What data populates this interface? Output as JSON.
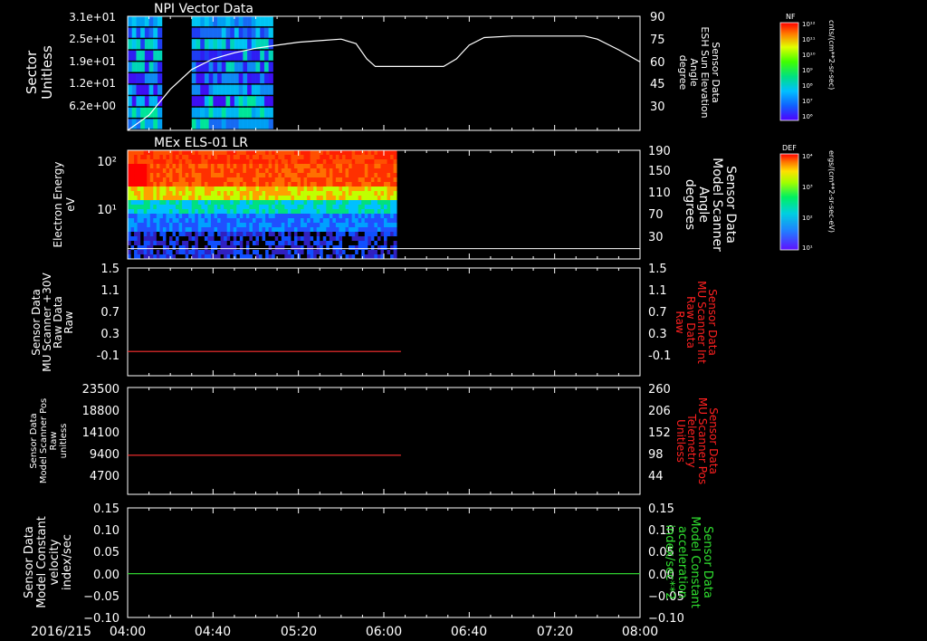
{
  "colors": {
    "background": "#000000",
    "axis": "#ffffff",
    "right_red": "#ff2020",
    "right_green": "#30e030",
    "line_red": "#ff3030",
    "line_green": "#30d030",
    "line_white": "#ffffff"
  },
  "date_label": "2016/215",
  "chart_data": [
    {
      "type": "heatmap",
      "title": "NPI Vector Data",
      "ylabel": [
        "Sector",
        "Unitless"
      ],
      "yticks": [
        "3.1e+01",
        "2.5e+01",
        "1.9e+01",
        "1.2e+01",
        "6.2e+00"
      ],
      "right_label": [
        "Sensor Data",
        "ESH Sun Elevation",
        "Angle",
        "degree"
      ],
      "right_ticks": [
        "90",
        "75",
        "60",
        "45",
        "30"
      ],
      "right_range": [
        15,
        90
      ],
      "colorbar": {
        "title": "NF",
        "unit": "cnts/(cm**2-sr-sec)",
        "labels": [
          "10¹²",
          "10¹¹",
          "10¹⁰",
          "10⁹",
          "10⁸",
          "10⁷",
          "10⁶"
        ]
      },
      "overlay_line": {
        "name": "ESH Sun Elevation Angle",
        "x": [
          "04:00",
          "04:10",
          "04:20",
          "04:30",
          "04:40",
          "04:50",
          "05:00",
          "05:10",
          "05:20",
          "05:30",
          "05:40",
          "05:47",
          "05:52",
          "05:56",
          "06:00",
          "06:20",
          "06:28",
          "06:34",
          "06:40",
          "06:47",
          "07:00",
          "07:20",
          "07:34",
          "07:40",
          "07:50",
          "08:00"
        ],
        "y": [
          15,
          25,
          42,
          55,
          62,
          66,
          69,
          71,
          73,
          74,
          75,
          72,
          62,
          57,
          57,
          57,
          57,
          62,
          71,
          76,
          77,
          77,
          77,
          75,
          68,
          60
        ]
      }
    },
    {
      "type": "heatmap",
      "title": "MEx ELS-01 LR",
      "ylabel": [
        "Electron Energy",
        "eV"
      ],
      "yticks": [
        "10²",
        "10¹"
      ],
      "right_label": [
        "Sensor Data",
        "Model Scanner",
        "Angle",
        "degrees"
      ],
      "right_ticks": [
        "190",
        "150",
        "110",
        "70",
        "30"
      ],
      "right_range": [
        0,
        190
      ],
      "colorbar": {
        "title": "DEF",
        "unit": "ergs/(cm**2-sr-sec-eV)",
        "labels": [
          "10⁴",
          "10³",
          "10²",
          "10¹"
        ]
      },
      "overlay_line": {
        "name": "Model Scanner Angle",
        "x": [
          "04:00",
          "08:00"
        ],
        "y": [
          18,
          18
        ]
      }
    },
    {
      "type": "line",
      "ylabel": [
        "Sensor Data",
        "MU Scanner +30V",
        "Raw Data",
        "Raw"
      ],
      "yticks": [
        "1.5",
        "1.1",
        "0.7",
        "0.3",
        "-0.1"
      ],
      "right_label": [
        "Sensor Data",
        "MU Scanner Int",
        "Raw Data",
        "Raw"
      ],
      "right_ticks": [
        "1.5",
        "1.1",
        "0.7",
        "0.3",
        "-0.1"
      ],
      "ylim": [
        -0.5,
        1.5
      ],
      "series": [
        {
          "x": [
            "04:00",
            "06:08"
          ],
          "y": [
            -0.05,
            -0.05
          ]
        }
      ]
    },
    {
      "type": "line",
      "ylabel": [
        "Sensor Data",
        "Model Scanner Pos",
        "Raw",
        "unitless"
      ],
      "yticks": [
        "23500",
        "18800",
        "14100",
        "9400",
        "4700"
      ],
      "right_label": [
        "Sensor Data",
        "MU Scanner Pos",
        "Telemetry",
        "Unitless"
      ],
      "right_ticks": [
        "260",
        "206",
        "152",
        "98",
        "44"
      ],
      "ylim": [
        0,
        23500
      ],
      "series": [
        {
          "x": [
            "04:00",
            "06:08"
          ],
          "y": [
            8600,
            8600
          ]
        }
      ]
    },
    {
      "type": "line",
      "ylabel": [
        "Sensor Data",
        "Model Constant",
        "velocity",
        "index/sec"
      ],
      "yticks": [
        "0.15",
        "0.10",
        "0.05",
        "0.00",
        "−0.05",
        "−0.10"
      ],
      "right_label": [
        "Sensor Data",
        "Model Constant",
        "acceleration",
        "index/sec**2"
      ],
      "right_ticks": [
        "0.15",
        "0.10",
        "0.05",
        "0.00",
        "−0.05",
        "−0.10"
      ],
      "ylim": [
        -0.1,
        0.15
      ],
      "series": [
        {
          "x": [
            "04:00",
            "08:00"
          ],
          "y": [
            0.0,
            0.0
          ]
        }
      ]
    }
  ],
  "xaxis": {
    "range": [
      "04:00",
      "08:00"
    ],
    "tick_labels": [
      "04:00",
      "04:40",
      "05:20",
      "06:00",
      "06:40",
      "07:20",
      "08:00"
    ]
  }
}
